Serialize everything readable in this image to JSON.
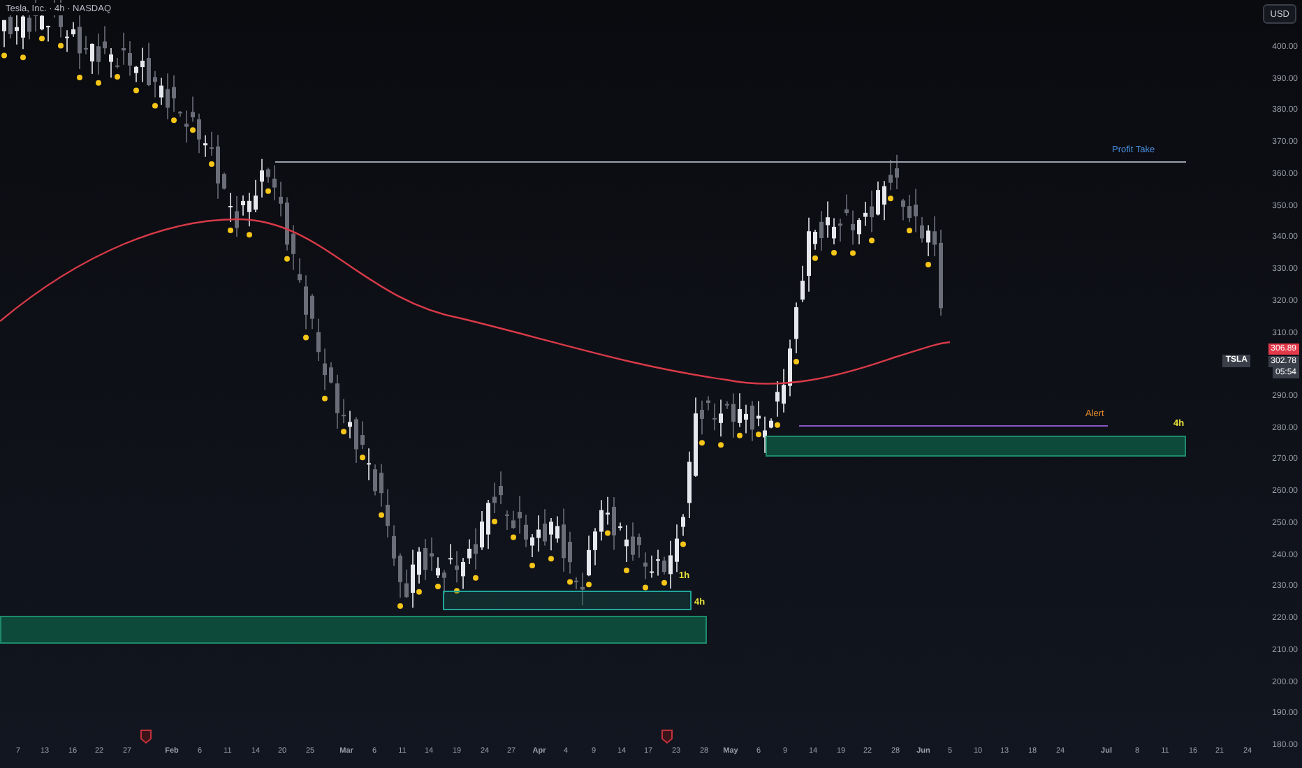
{
  "chart": {
    "title": "Tesla, Inc. · 4h · NASDAQ",
    "annotations": [
      {
        "text": "Profit Take",
        "color": "#4a8fe0"
      },
      {
        "text": "Alert",
        "color": "#e08a2c"
      },
      {
        "text": "4h",
        "color": "#e8e23a"
      },
      {
        "text": "1h",
        "color": "#e8e23a"
      },
      {
        "text": "4h",
        "color": "#e8e23a"
      }
    ]
  },
  "price_axis": {
    "currency": "USD",
    "labels": [
      "400.00",
      "390.00",
      "380.00",
      "370.00",
      "360.00",
      "350.00",
      "340.00",
      "330.00",
      "320.00",
      "310.00",
      "290.00",
      "280.00",
      "270.00",
      "260.00",
      "250.00",
      "240.00",
      "230.00",
      "220.00",
      "210.00",
      "200.00",
      "190.00",
      "180.00"
    ],
    "ma_price": "306.89",
    "last_price": "302.78",
    "countdown": "05:54",
    "symbol": "TSLA"
  },
  "date_axis": {
    "labels": [
      "7",
      "13",
      "16",
      "22",
      "27",
      "Feb",
      "6",
      "11",
      "14",
      "20",
      "25",
      "Mar",
      "6",
      "11",
      "14",
      "19",
      "24",
      "27",
      "Apr",
      "4",
      "9",
      "14",
      "17",
      "23",
      "28",
      "May",
      "6",
      "9",
      "14",
      "19",
      "22",
      "28",
      "Jun",
      "5",
      "10",
      "13",
      "18",
      "24",
      "Jul",
      "8",
      "11",
      "16",
      "21",
      "24"
    ]
  }
}
